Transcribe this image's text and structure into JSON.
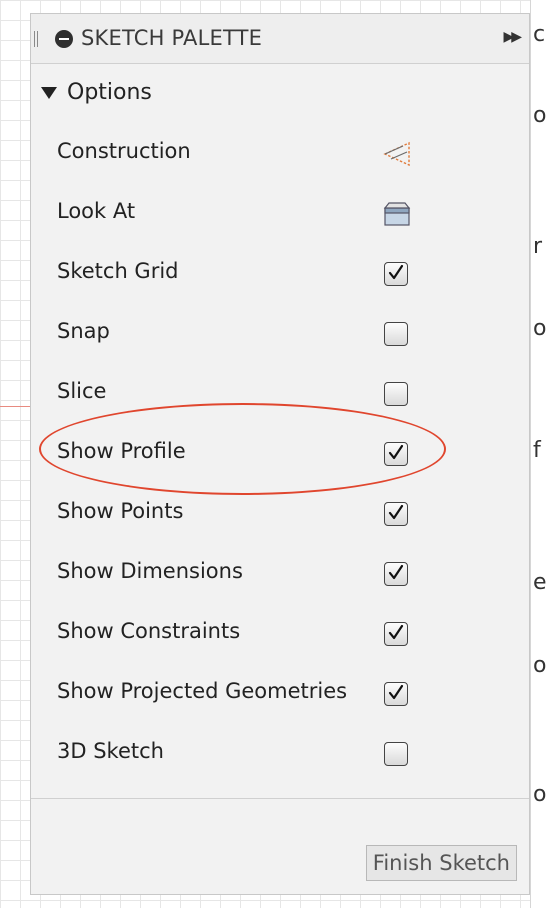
{
  "palette": {
    "title": "SKETCH PALETTE",
    "section_label": "Options",
    "rows": [
      {
        "label": "Construction",
        "kind": "icon",
        "icon": "construction-icon"
      },
      {
        "label": "Look At",
        "kind": "icon",
        "icon": "look-at-icon"
      },
      {
        "label": "Sketch Grid",
        "kind": "checkbox",
        "checked": true
      },
      {
        "label": "Snap",
        "kind": "checkbox",
        "checked": false
      },
      {
        "label": "Slice",
        "kind": "checkbox",
        "checked": false
      },
      {
        "label": "Show Profile",
        "kind": "checkbox",
        "checked": true,
        "highlighted": true
      },
      {
        "label": "Show Points",
        "kind": "checkbox",
        "checked": true
      },
      {
        "label": "Show Dimensions",
        "kind": "checkbox",
        "checked": true
      },
      {
        "label": "Show Constraints",
        "kind": "checkbox",
        "checked": true
      },
      {
        "label": "Show Projected Geometries",
        "kind": "checkbox",
        "checked": true
      },
      {
        "label": "3D Sketch",
        "kind": "checkbox",
        "checked": false
      }
    ],
    "finish_label": "Finish Sketch"
  },
  "colors": {
    "highlight": "#e0462e",
    "panel": "#f2f2f2"
  }
}
